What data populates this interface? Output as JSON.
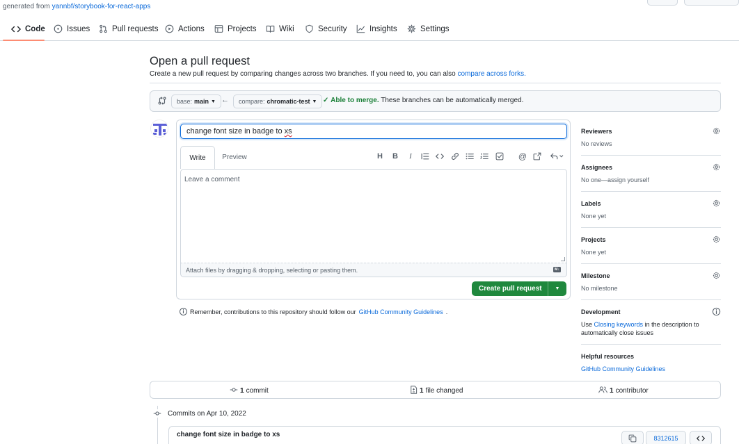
{
  "header": {
    "generated_prefix": "generated from",
    "generated_link": "yannbf/storybook-for-react-apps"
  },
  "nav": {
    "items": [
      {
        "label": "Code",
        "icon": "code-icon"
      },
      {
        "label": "Issues",
        "icon": "issue-opened-icon"
      },
      {
        "label": "Pull requests",
        "icon": "git-pull-request-icon"
      },
      {
        "label": "Actions",
        "icon": "play-icon"
      },
      {
        "label": "Projects",
        "icon": "table-icon"
      },
      {
        "label": "Wiki",
        "icon": "book-icon"
      },
      {
        "label": "Security",
        "icon": "shield-icon"
      },
      {
        "label": "Insights",
        "icon": "graph-icon"
      },
      {
        "label": "Settings",
        "icon": "gear-icon"
      }
    ],
    "active": "Code"
  },
  "page": {
    "title": "Open a pull request",
    "subtitle": "Create a new pull request by comparing changes across two branches. If you need to, you can also",
    "subtitle_link": "compare across forks."
  },
  "compare": {
    "base_prefix": "base:",
    "base_branch": "main",
    "compare_prefix": "compare:",
    "compare_branch": "chromatic-test",
    "merge_status": "Able to merge.",
    "merge_detail": "These branches can be automatically merged."
  },
  "form": {
    "title_before": "change font size in badge to ",
    "title_misspelled": "xs",
    "tabs": {
      "write": "Write",
      "preview": "Preview"
    },
    "comment_placeholder": "Leave a comment",
    "attach_hint": "Attach files by dragging & dropping, selecting or pasting them.",
    "create_button": "Create pull request"
  },
  "guidelines": {
    "text": "Remember, contributions to this repository should follow our",
    "link": "GitHub Community Guidelines",
    "suffix": "."
  },
  "sidebar": {
    "reviewers": {
      "title": "Reviewers",
      "value": "No reviews"
    },
    "assignees": {
      "title": "Assignees",
      "value": "No one—assign yourself"
    },
    "labels": {
      "title": "Labels",
      "value": "None yet"
    },
    "projects": {
      "title": "Projects",
      "value": "None yet"
    },
    "milestone": {
      "title": "Milestone",
      "value": "No milestone"
    },
    "development": {
      "title": "Development",
      "value_prefix": "Use",
      "value_link": "Closing keywords",
      "value_suffix": "in the description to automatically close issues"
    },
    "helpful": {
      "title": "Helpful resources",
      "link": "GitHub Community Guidelines"
    }
  },
  "summary": {
    "commits_count": "1",
    "commits_label": "commit",
    "files_count": "1",
    "files_label": "file changed",
    "contributors_count": "1",
    "contributors_label": "contributor"
  },
  "commits": {
    "heading": "Commits on Apr 10, 2022",
    "items": [
      {
        "title": "change font size in badge to xs",
        "sha": "8312615"
      }
    ]
  },
  "colors": {
    "accent": "#0969da",
    "success": "#1a7f37",
    "primary_button": "#1f883d",
    "nav_underline": "#fd8c73"
  }
}
